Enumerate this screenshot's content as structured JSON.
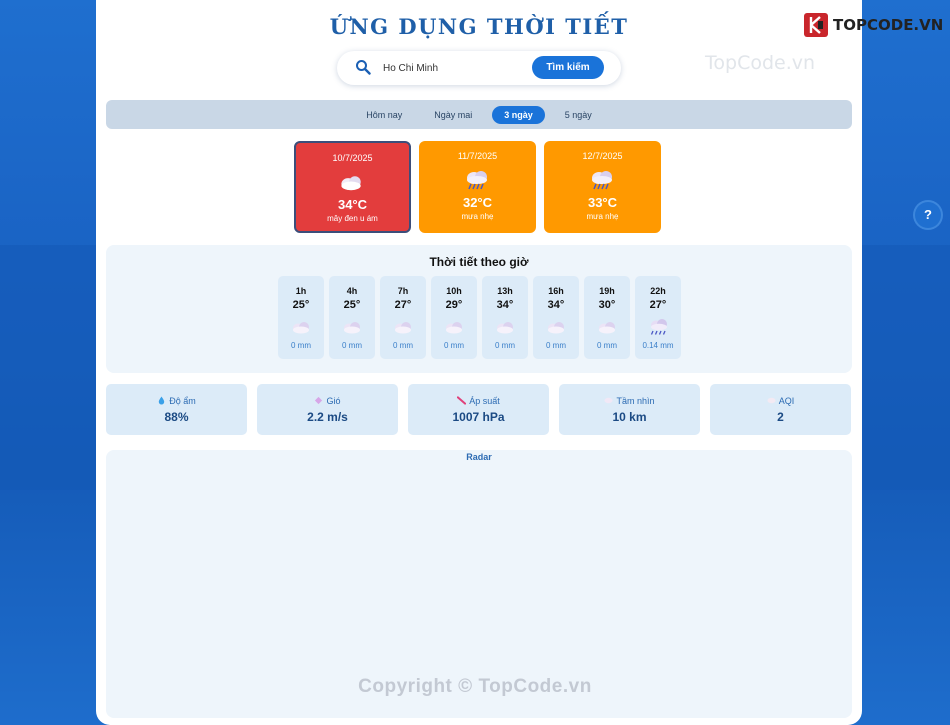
{
  "app": {
    "title": "ỨNG DỤNG THỜI TIẾT"
  },
  "search": {
    "value": "Ho Chi Minh",
    "button_label": "Tìm kiếm",
    "icon": "search-icon"
  },
  "tabs": [
    {
      "label": "Hôm nay",
      "active": false
    },
    {
      "label": "Ngày mai",
      "active": false
    },
    {
      "label": "3 ngày",
      "active": true
    },
    {
      "label": "5 ngày",
      "active": false
    }
  ],
  "days": [
    {
      "date": "10/7/2025",
      "temp": "34°C",
      "desc": "mây đen u ám",
      "icon": "cloud-icon",
      "color": "#e33d3d",
      "selected": true
    },
    {
      "date": "11/7/2025",
      "temp": "32°C",
      "desc": "mưa nhẹ",
      "icon": "rain-cloud-icon",
      "color": "#ff9900",
      "selected": false
    },
    {
      "date": "12/7/2025",
      "temp": "33°C",
      "desc": "mưa nhẹ",
      "icon": "rain-cloud-icon",
      "color": "#ff9900",
      "selected": false
    }
  ],
  "hourly": {
    "title": "Thời tiết theo giờ",
    "items": [
      {
        "time": "1h",
        "temp": "25°",
        "rain": "0 mm",
        "icon": "cloud-icon"
      },
      {
        "time": "4h",
        "temp": "25°",
        "rain": "0 mm",
        "icon": "cloud-icon"
      },
      {
        "time": "7h",
        "temp": "27°",
        "rain": "0 mm",
        "icon": "cloud-icon"
      },
      {
        "time": "10h",
        "temp": "29°",
        "rain": "0 mm",
        "icon": "cloud-icon"
      },
      {
        "time": "13h",
        "temp": "34°",
        "rain": "0 mm",
        "icon": "cloud-icon"
      },
      {
        "time": "16h",
        "temp": "34°",
        "rain": "0 mm",
        "icon": "cloud-icon"
      },
      {
        "time": "19h",
        "temp": "30°",
        "rain": "0 mm",
        "icon": "cloud-icon"
      },
      {
        "time": "22h",
        "temp": "27°",
        "rain": "0.14 mm",
        "icon": "rain-cloud-icon"
      }
    ]
  },
  "metrics": [
    {
      "label": "Độ ẩm",
      "value": "88%",
      "icon": "droplet-icon"
    },
    {
      "label": "Gió",
      "value": "2.2 m/s",
      "icon": "wind-icon"
    },
    {
      "label": "Áp suất",
      "value": "1007 hPa",
      "icon": "gauge-icon"
    },
    {
      "label": "Tầm nhìn",
      "value": "10 km",
      "icon": "fog-icon"
    },
    {
      "label": "AQI",
      "value": "2",
      "icon": "air-quality-icon"
    }
  ],
  "radar": {
    "title": "Radar"
  },
  "branding": {
    "logo_text": "TOPCODE.VN",
    "watermark": "TopCode.vn",
    "copyright": "Copyright © TopCode.vn"
  },
  "help": {
    "label": "?"
  },
  "colors": {
    "accent": "#1a73d9",
    "selected_day": "#e33d3d",
    "other_day": "#ff9900",
    "title": "#1f5fa8"
  }
}
